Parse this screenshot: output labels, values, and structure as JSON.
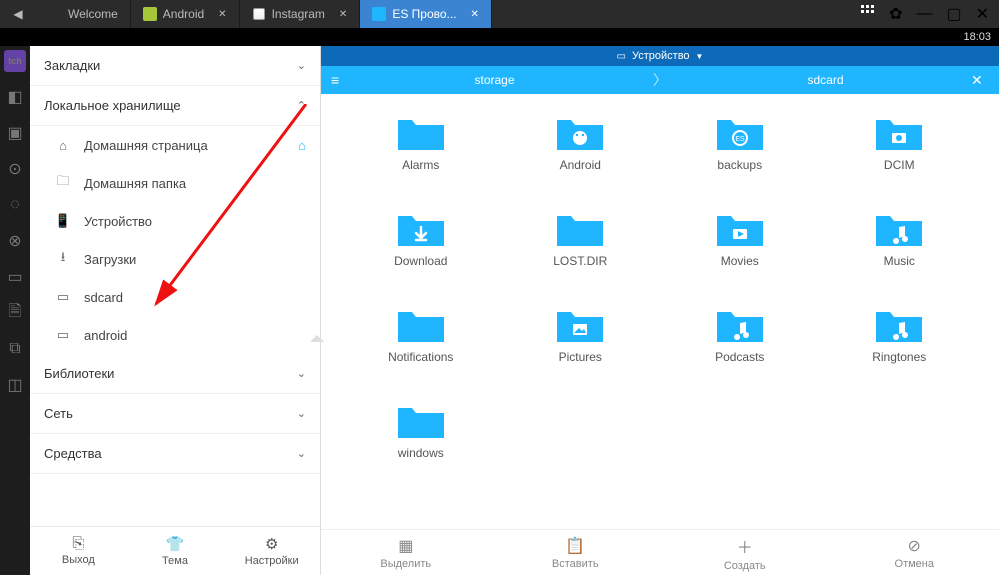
{
  "clock": "18:03",
  "titlebar_icons": [
    "grid",
    "gear",
    "min",
    "max",
    "close"
  ],
  "tabs": [
    {
      "label": "Welcome",
      "icon": "welcome",
      "active": false,
      "closable": false
    },
    {
      "label": "Android",
      "icon": "android",
      "active": false,
      "closable": true
    },
    {
      "label": "Instagram",
      "icon": "instagram",
      "active": false,
      "closable": true
    },
    {
      "label": "ES Прово...",
      "icon": "es",
      "active": true,
      "closable": true
    }
  ],
  "sidebar": {
    "sections": {
      "bookmarks": {
        "label": "Закладки",
        "expanded": false
      },
      "local": {
        "label": "Локальное хранилище",
        "expanded": true
      },
      "libraries": {
        "label": "Библиотеки",
        "expanded": false
      },
      "network": {
        "label": "Сеть",
        "expanded": false
      },
      "tools": {
        "label": "Средства",
        "expanded": false
      }
    },
    "local_items": [
      {
        "name": "home-page",
        "label": "Домашняя страница",
        "tail": "home"
      },
      {
        "name": "home-folder",
        "label": "Домашняя папка"
      },
      {
        "name": "device",
        "label": "Устройство"
      },
      {
        "name": "downloads",
        "label": "Загрузки"
      },
      {
        "name": "sdcard",
        "label": "sdcard"
      },
      {
        "name": "android",
        "label": "android",
        "tail": "eject"
      }
    ],
    "bottom": [
      {
        "name": "exit",
        "label": "Выход"
      },
      {
        "name": "theme",
        "label": "Тема"
      },
      {
        "name": "settings",
        "label": "Настройки"
      }
    ]
  },
  "location": {
    "device": "Устройство"
  },
  "path": {
    "seg1": "storage",
    "seg2": "sdcard"
  },
  "folders": [
    {
      "name": "Alarms",
      "icon": "plain"
    },
    {
      "name": "Android",
      "icon": "android"
    },
    {
      "name": "backups",
      "icon": "es"
    },
    {
      "name": "DCIM",
      "icon": "camera"
    },
    {
      "name": "Download",
      "icon": "download"
    },
    {
      "name": "LOST.DIR",
      "icon": "plain"
    },
    {
      "name": "Movies",
      "icon": "video"
    },
    {
      "name": "Music",
      "icon": "music"
    },
    {
      "name": "Notifications",
      "icon": "plain"
    },
    {
      "name": "Pictures",
      "icon": "picture"
    },
    {
      "name": "Podcasts",
      "icon": "music"
    },
    {
      "name": "Ringtones",
      "icon": "music"
    },
    {
      "name": "windows",
      "icon": "plain"
    }
  ],
  "toolbar": [
    {
      "name": "select",
      "label": "Выделить"
    },
    {
      "name": "paste",
      "label": "Вставить"
    },
    {
      "name": "create",
      "label": "Создать"
    },
    {
      "name": "cancel",
      "label": "Отмена"
    }
  ]
}
